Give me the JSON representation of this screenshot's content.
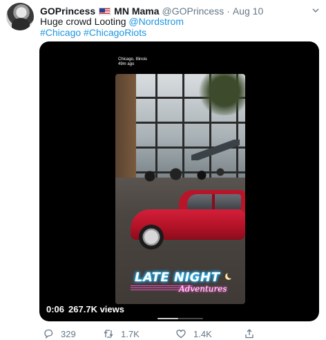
{
  "tweet": {
    "display_name": "GOPrincess",
    "display_name_suffix": "MN Mama",
    "handle": "@GOPrincess",
    "separator": "·",
    "date": "Aug 10",
    "text_prefix": "Huge crowd Looting ",
    "mention": "@Nordstrom",
    "hashtag1": "#Chicago",
    "hashtag2": "#ChicagoRiots"
  },
  "video": {
    "overlay_location": "Chicago, Illinois",
    "overlay_time": "49m ago",
    "badge_line1": "LATE NIGHT",
    "badge_line2": "Adventures",
    "elapsed": "0:06",
    "views": "267.7K views",
    "progress_fraction": 0.45
  },
  "actions": {
    "reply_count": "329",
    "retweet_count": "1.7K",
    "like_count": "1.4K"
  },
  "colors": {
    "link": "#1b95e0",
    "muted": "#657786",
    "text": "#14171a"
  }
}
